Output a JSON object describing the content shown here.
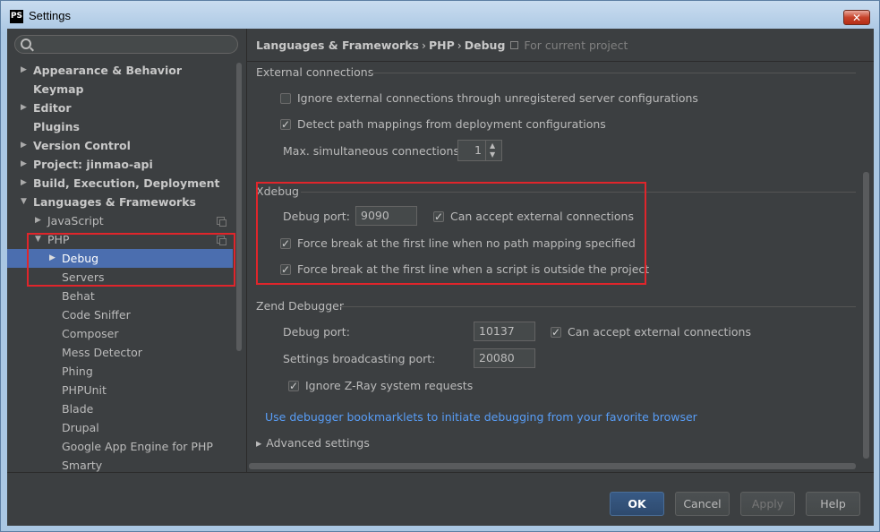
{
  "window": {
    "title": "Settings",
    "app_icon": "PS"
  },
  "search": {
    "placeholder": ""
  },
  "sidebar": {
    "items": [
      {
        "label": "Appearance & Behavior",
        "arrow": "▶"
      },
      {
        "label": "Keymap"
      },
      {
        "label": "Editor",
        "arrow": "▶"
      },
      {
        "label": "Plugins"
      },
      {
        "label": "Version Control",
        "arrow": "▶"
      },
      {
        "label": "Project: jinmao-api",
        "arrow": "▶"
      },
      {
        "label": "Build, Execution, Deployment",
        "arrow": "▶"
      },
      {
        "label": "Languages & Frameworks",
        "arrow": "▼"
      },
      {
        "label": "JavaScript",
        "arrow": "▶"
      },
      {
        "label": "PHP",
        "arrow": "▼"
      },
      {
        "label": "Debug",
        "arrow": "▶"
      },
      {
        "label": "Servers"
      },
      {
        "label": "Behat"
      },
      {
        "label": "Code Sniffer"
      },
      {
        "label": "Composer"
      },
      {
        "label": "Mess Detector"
      },
      {
        "label": "Phing"
      },
      {
        "label": "PHPUnit"
      },
      {
        "label": "Blade"
      },
      {
        "label": "Drupal"
      },
      {
        "label": "Google App Engine for PHP"
      },
      {
        "label": "Smarty"
      }
    ]
  },
  "breadcrumb": {
    "part1": "Languages & Frameworks",
    "part2": "PHP",
    "part3": "Debug",
    "sep": "›",
    "note": "For current project"
  },
  "external": {
    "title": "External connections",
    "ignore_label": "Ignore external connections through unregistered server configurations",
    "detect_label": "Detect path mappings from deployment configurations",
    "max_label": "Max. simultaneous connections:",
    "max_value": "1"
  },
  "xdebug": {
    "title": "Xdebug",
    "port_label": "Debug port:",
    "port_value": "9090",
    "accept_label": "Can accept external connections",
    "force1_label": "Force break at the first line when no path mapping specified",
    "force2_label": "Force break at the first line when a script is outside the project"
  },
  "zend": {
    "title": "Zend Debugger",
    "port_label": "Debug port:",
    "port_value": "10137",
    "accept_label": "Can accept external connections",
    "broadcast_label": "Settings broadcasting port:",
    "broadcast_value": "20080",
    "zray_label": "Ignore Z-Ray system requests"
  },
  "link_text": "Use debugger bookmarklets to initiate debugging from your favorite browser",
  "advanced": {
    "arrow": "▸",
    "label": "Advanced settings"
  },
  "buttons": {
    "ok": "OK",
    "cancel": "Cancel",
    "apply": "Apply",
    "help": "Help"
  },
  "colors": {
    "selection": "#4b6eaf",
    "highlight_box": "#e0252b",
    "link": "#589df6",
    "panel_bg": "#3c3f41"
  }
}
